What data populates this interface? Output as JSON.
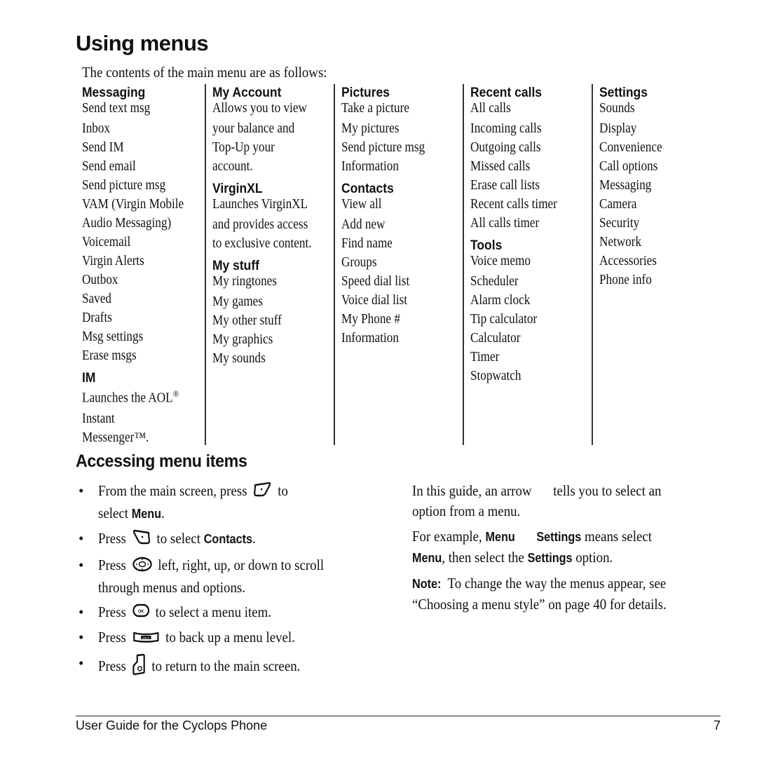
{
  "page": {
    "title": "Using menus",
    "intro": "The contents of the main menu are as follows:"
  },
  "menu_columns": [
    {
      "groups": [
        {
          "heading": "Messaging",
          "items": [
            "Send text msg",
            "Inbox",
            "Send IM",
            "Send email",
            "Send picture msg",
            "VAM (Virgin Mobile",
            "Audio Messaging)",
            "Voicemail",
            "Virgin Alerts",
            "Outbox",
            "Saved",
            "Drafts",
            "Msg settings",
            "Erase msgs"
          ]
        },
        {
          "heading": "IM",
          "items": [
            "Launches the AOL®",
            "Instant",
            "Messenger™."
          ]
        }
      ]
    },
    {
      "groups": [
        {
          "heading": "My Account",
          "items": [
            "Allows you to view",
            "your balance and",
            "Top-Up your",
            "account."
          ]
        },
        {
          "heading": "VirginXL",
          "items": [
            "Launches VirginXL",
            "and provides access",
            "to exclusive content."
          ]
        },
        {
          "heading": "My stuff",
          "items": [
            "My ringtones",
            "My games",
            "My other stuff",
            "My graphics",
            "My sounds"
          ]
        }
      ]
    },
    {
      "groups": [
        {
          "heading": "Pictures",
          "items": [
            "Take a picture",
            "My pictures",
            "Send picture msg",
            "Information"
          ]
        },
        {
          "heading": "Contacts",
          "items": [
            "View all",
            "Add new",
            "Find name",
            "Groups",
            "Speed dial list",
            "Voice dial list",
            "My Phone #",
            "Information"
          ]
        }
      ]
    },
    {
      "groups": [
        {
          "heading": "Recent calls",
          "items": [
            "All calls",
            "Incoming calls",
            "Outgoing calls",
            "Missed calls",
            "Erase call lists",
            "Recent calls timer",
            "All calls timer"
          ]
        },
        {
          "heading": "Tools",
          "items": [
            "Voice memo",
            "Scheduler",
            "Alarm clock",
            "Tip calculator",
            "Calculator",
            "Timer",
            "Stopwatch"
          ]
        }
      ]
    },
    {
      "groups": [
        {
          "heading": "Settings",
          "items": [
            "Sounds",
            "Display",
            "Convenience",
            "Call options",
            "Messaging",
            "Camera",
            "Security",
            "Network",
            "Accessories",
            "Phone info"
          ]
        }
      ]
    }
  ],
  "accessing": {
    "title": "Accessing menu items",
    "bullets": [
      {
        "pre": "From the main screen, press",
        "icon": "left-softkey-icon",
        "post": "to",
        "line2_pre": "select ",
        "line2_bold": "Menu",
        "line2_post": "."
      },
      {
        "pre": "Press",
        "icon": "right-softkey-icon",
        "post": "to select ",
        "bold": "Contacts",
        "tail": "."
      },
      {
        "pre": "Press",
        "icon": "nav-key-icon",
        "post": "left, right, up, or down to scroll",
        "line2": "through menus and options."
      },
      {
        "pre": "Press",
        "icon": "ok-key-icon",
        "post": "to select a menu item."
      },
      {
        "pre": "Press",
        "icon": "back-key-icon",
        "post": "to back up a menu level."
      },
      {
        "pre": "Press",
        "icon": "end-key-icon",
        "post": "to return to the main screen."
      }
    ],
    "bullet_char": "•",
    "back_key_label": "BACK",
    "ok_key_label": "OK"
  },
  "right_column": {
    "p1_pre": "In this guide, an arrow",
    "p1_post": "tells you to select an",
    "p1_line2": "option from a menu.",
    "p2_pre": "For example, ",
    "p2_menu": "Menu",
    "p2_settings": "Settings",
    "p2_mid": " means select",
    "p2_line2_menu": "Menu",
    "p2_line2_mid": ", then select the ",
    "p2_line2_settings": "Settings",
    "p2_line2_post": " option.",
    "note_label": "Note:",
    "note_text": "  To change the way the menus appear, see",
    "note_line2": "“Choosing a menu style” on page 40 for details."
  },
  "footer": {
    "left": "User Guide for the Cyclops Phone",
    "page_number": "7"
  }
}
